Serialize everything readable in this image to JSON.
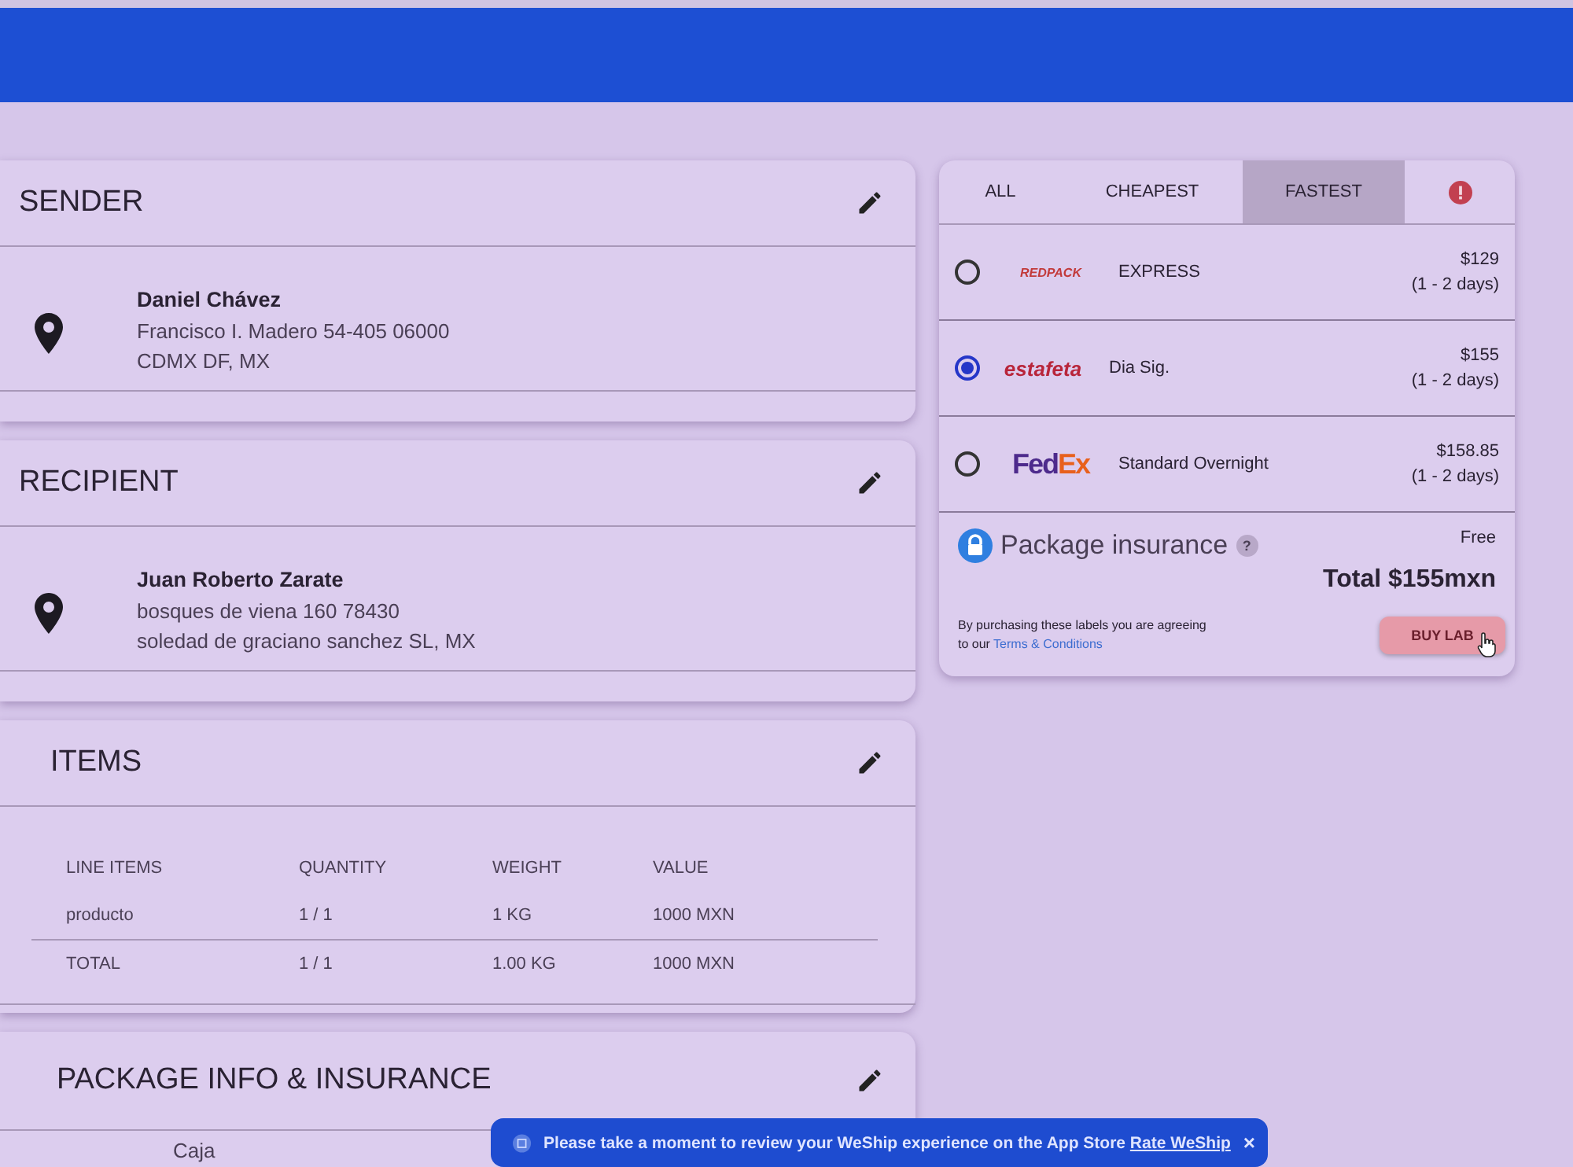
{
  "sender": {
    "title": "SENDER",
    "name": "Daniel Chávez",
    "address_line_1": "Francisco I. Madero 54-405 06000",
    "address_line_2": "CDMX DF, MX"
  },
  "recipient": {
    "title": "RECIPIENT",
    "name": "Juan Roberto Zarate",
    "address_line_1": "bosques de viena 160 78430",
    "address_line_2": "soledad de graciano sanchez SL, MX"
  },
  "items": {
    "title": "ITEMS",
    "columns": [
      "LINE ITEMS",
      "QUANTITY",
      "WEIGHT",
      "VALUE"
    ],
    "rows": [
      [
        "producto",
        "1 / 1",
        "1 KG",
        "1000 MXN"
      ],
      [
        "TOTAL",
        "1 / 1",
        "1.00 KG",
        "1000 MXN"
      ]
    ]
  },
  "package": {
    "title": "PACKAGE INFO & INSURANCE",
    "box_type": "Caja"
  },
  "rates": {
    "tabs": [
      {
        "label": "ALL",
        "selected": false
      },
      {
        "label": "CHEAPEST",
        "selected": false
      },
      {
        "label": "FASTEST",
        "selected": true
      }
    ],
    "alert_tab": {
      "selected": false
    },
    "options": [
      {
        "kind": "redpack",
        "logo": "REDPACK",
        "service": "EXPRESS",
        "price": "$129",
        "days": "(1 - 2 days)",
        "selected": false
      },
      {
        "kind": "estafeta",
        "logo": "estafeta",
        "service": "Dia Sig.",
        "price": "$155",
        "days": "(1 - 2 days)",
        "selected": true
      },
      {
        "kind": "fedex",
        "logo": "FedEx",
        "service": "Standard Overnight",
        "price": "$158.85",
        "days": "(1 - 2 days)",
        "selected": false
      }
    ],
    "insurance_label": "Package insurance",
    "help": "?",
    "insurance_price": "Free",
    "total": "Total $155mxn",
    "terms_text": "By purchasing these labels you are agreeing to our",
    "terms_link": "Terms & Conditions",
    "buy_button": "BUY LAB"
  },
  "snackbar": {
    "message": "Please take a moment to review your WeShip experience on the App Store",
    "link": "Rate WeShip",
    "close": "×"
  }
}
